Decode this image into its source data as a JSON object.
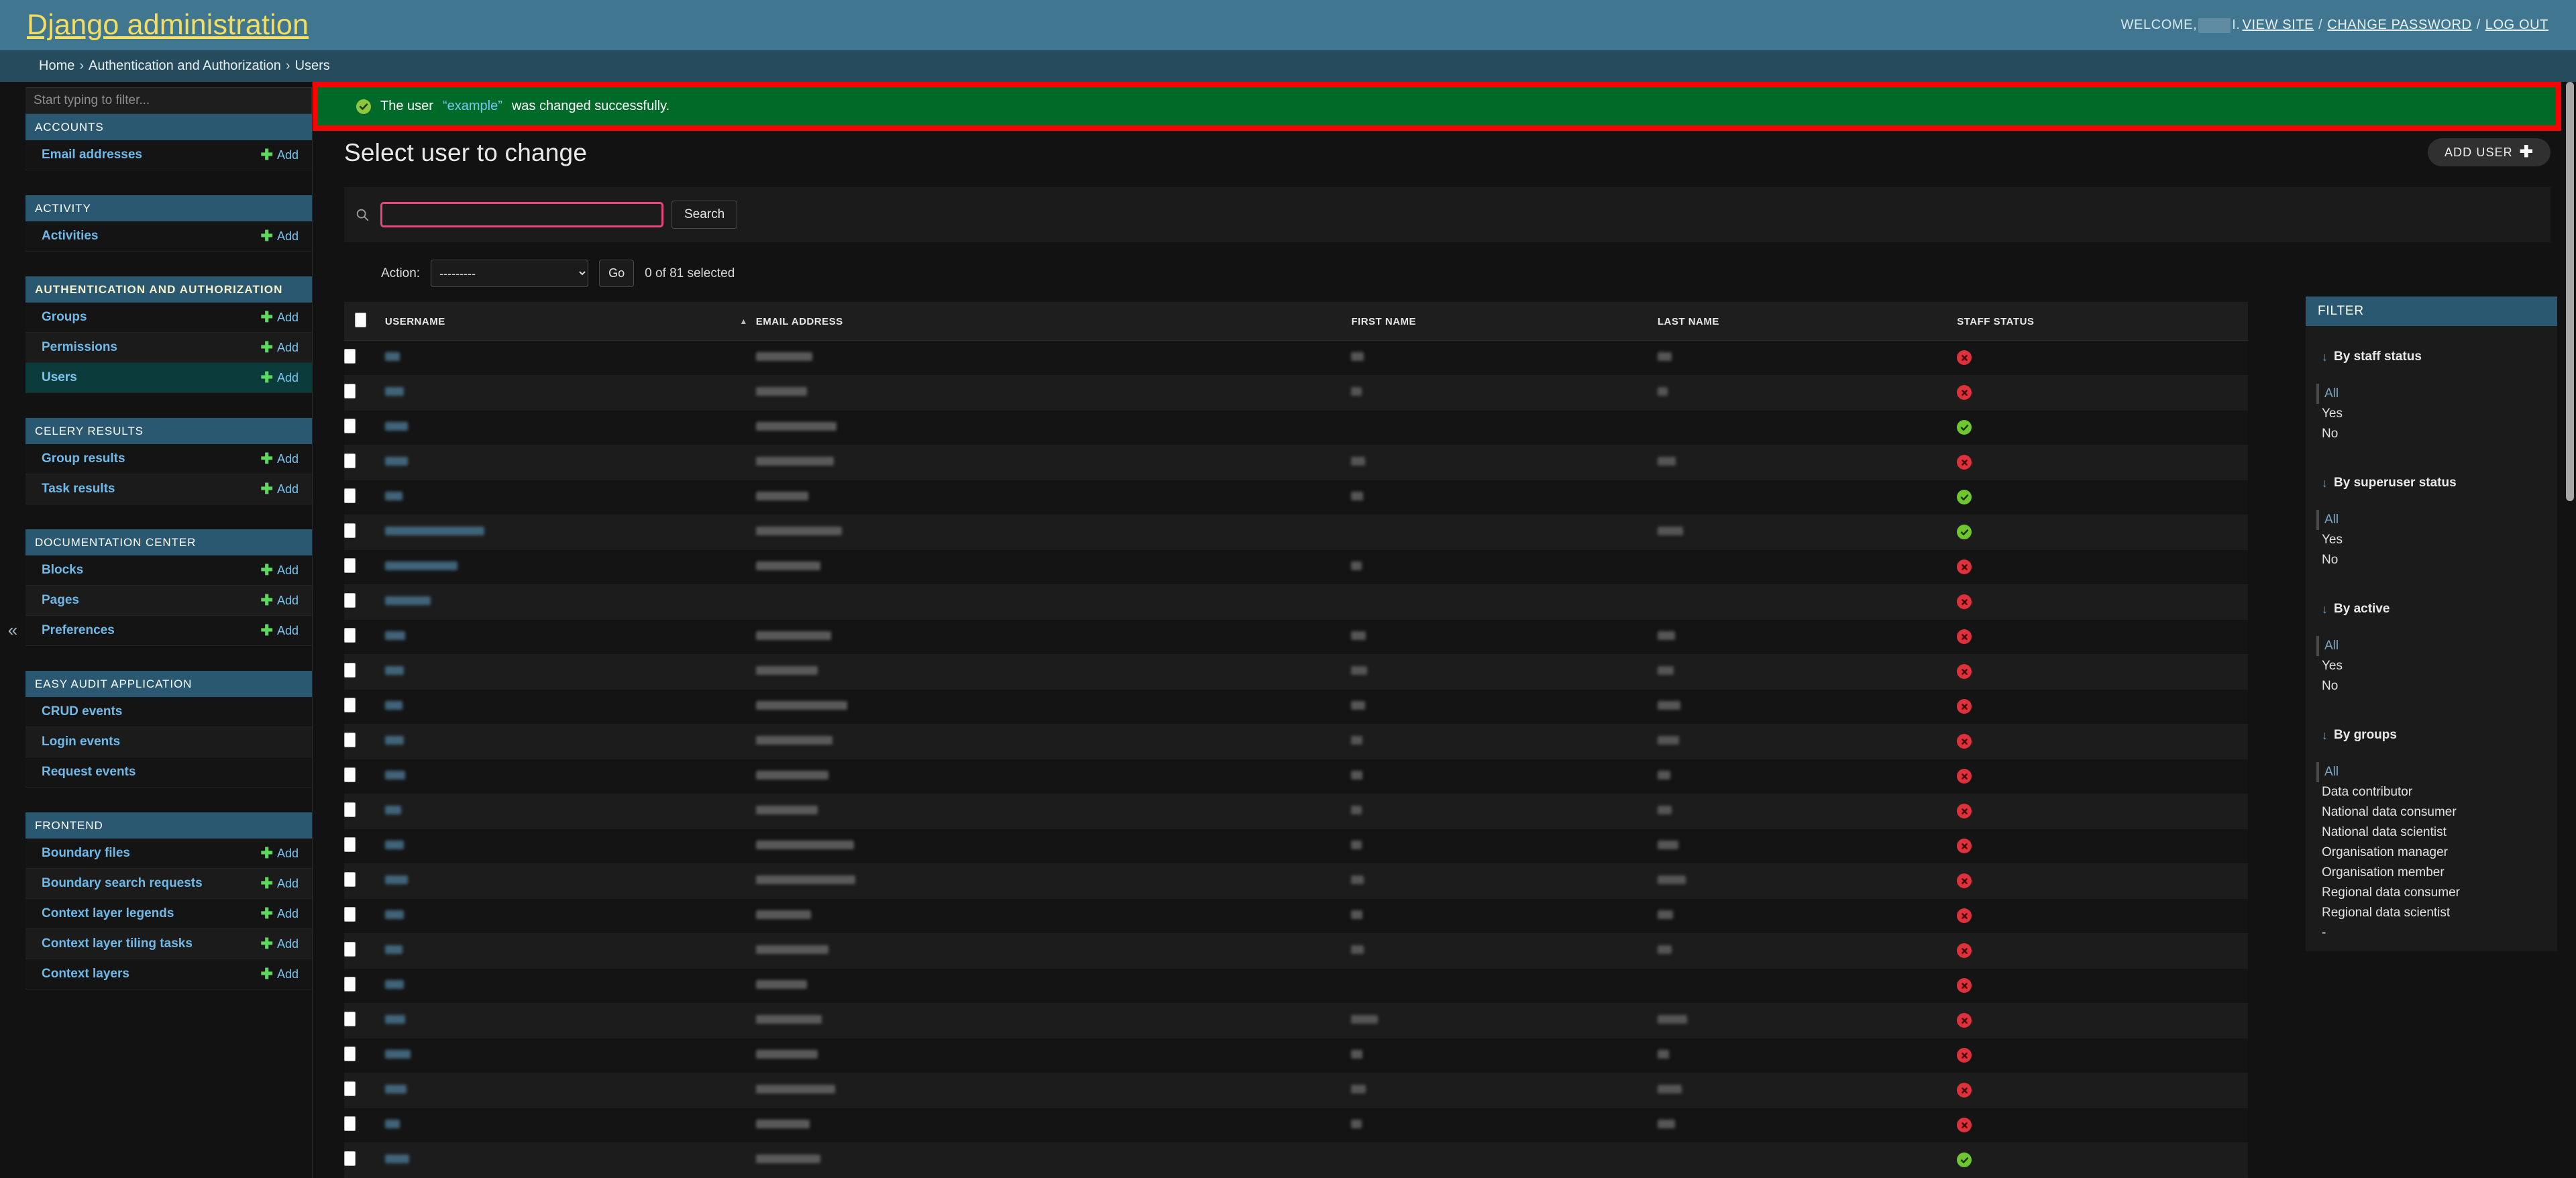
{
  "header": {
    "site_name": "Django administration",
    "welcome_label": "WELCOME,",
    "username_redacted": "",
    "username_suffix": "I.",
    "links": [
      {
        "label": "VIEW SITE"
      },
      {
        "label": "CHANGE PASSWORD"
      },
      {
        "label": "LOG OUT"
      }
    ],
    "separator": "/"
  },
  "breadcrumbs": {
    "items": [
      {
        "label": "Home"
      },
      {
        "label": "Authentication and Authorization"
      },
      {
        "label": "Users"
      }
    ],
    "separator": "›"
  },
  "message": {
    "text_before": "The user",
    "object_link": "“example”",
    "text_after": "was changed successfully.",
    "icon": "check-circle-icon",
    "background": "#006b28",
    "highlight_border": "#ff0000"
  },
  "nav_sidebar": {
    "filter_placeholder": "Start typing to filter...",
    "filter_value": "",
    "collapse_icon": "«",
    "add_label": "Add",
    "modules": [
      {
        "caption": "ACCOUNTS",
        "highlight": false,
        "items": [
          {
            "label": "Email addresses",
            "has_add": true,
            "current": false
          }
        ]
      },
      {
        "caption": "ACTIVITY",
        "highlight": false,
        "items": [
          {
            "label": "Activities",
            "has_add": true,
            "current": false
          }
        ]
      },
      {
        "caption": "AUTHENTICATION AND AUTHORIZATION",
        "highlight": true,
        "items": [
          {
            "label": "Groups",
            "has_add": true,
            "current": false
          },
          {
            "label": "Permissions",
            "has_add": true,
            "current": false
          },
          {
            "label": "Users",
            "has_add": true,
            "current": true
          }
        ]
      },
      {
        "caption": "CELERY RESULTS",
        "highlight": false,
        "items": [
          {
            "label": "Group results",
            "has_add": true,
            "current": false
          },
          {
            "label": "Task results",
            "has_add": true,
            "current": false
          }
        ]
      },
      {
        "caption": "DOCUMENTATION CENTER",
        "highlight": false,
        "items": [
          {
            "label": "Blocks",
            "has_add": true,
            "current": false
          },
          {
            "label": "Pages",
            "has_add": true,
            "current": false
          },
          {
            "label": "Preferences",
            "has_add": true,
            "current": false
          }
        ]
      },
      {
        "caption": "EASY AUDIT APPLICATION",
        "highlight": false,
        "items": [
          {
            "label": "CRUD events",
            "has_add": false,
            "current": false
          },
          {
            "label": "Login events",
            "has_add": false,
            "current": false
          },
          {
            "label": "Request events",
            "has_add": false,
            "current": false
          }
        ]
      },
      {
        "caption": "FRONTEND",
        "highlight": false,
        "items": [
          {
            "label": "Boundary files",
            "has_add": true,
            "current": false
          },
          {
            "label": "Boundary search requests",
            "has_add": true,
            "current": false
          },
          {
            "label": "Context layer legends",
            "has_add": true,
            "current": false
          },
          {
            "label": "Context layer tiling tasks",
            "has_add": true,
            "current": false
          },
          {
            "label": "Context layers",
            "has_add": true,
            "current": false
          }
        ]
      }
    ]
  },
  "main": {
    "page_title": "Select user to change",
    "add_button_label": "ADD USER",
    "search": {
      "placeholder": "",
      "value": "",
      "submit_label": "Search",
      "icon": "search-icon",
      "focus_outline_color": "#e8467c"
    },
    "actions": {
      "label": "Action:",
      "selected_option": "---------",
      "options": [
        "---------"
      ],
      "go_label": "Go",
      "counter": "0 of 81 selected"
    },
    "table": {
      "columns": [
        {
          "label": "USERNAME",
          "sorted": "asc"
        },
        {
          "label": "EMAIL ADDRESS",
          "sorted": ""
        },
        {
          "label": "FIRST NAME",
          "sorted": ""
        },
        {
          "label": "LAST NAME",
          "sorted": ""
        },
        {
          "label": "STAFF STATUS",
          "sorted": ""
        }
      ],
      "rows": [
        {
          "username_w": 22,
          "email_w": 84,
          "first_w": 19,
          "last_w": 21,
          "staff": "no"
        },
        {
          "username_w": 28,
          "email_w": 76,
          "first_w": 16,
          "last_w": 15,
          "staff": "no"
        },
        {
          "username_w": 34,
          "email_w": 120,
          "first_w": 0,
          "last_w": 0,
          "staff": "yes"
        },
        {
          "username_w": 34,
          "email_w": 116,
          "first_w": 21,
          "last_w": 27,
          "staff": "no"
        },
        {
          "username_w": 26,
          "email_w": 78,
          "first_w": 18,
          "last_w": 0,
          "staff": "yes"
        },
        {
          "username_w": 148,
          "email_w": 128,
          "first_w": 0,
          "last_w": 38,
          "staff": "yes"
        },
        {
          "username_w": 108,
          "email_w": 96,
          "first_w": 16,
          "last_w": 0,
          "staff": "no"
        },
        {
          "username_w": 68,
          "email_w": 0,
          "first_w": 0,
          "last_w": 0,
          "staff": "no"
        },
        {
          "username_w": 30,
          "email_w": 112,
          "first_w": 22,
          "last_w": 26,
          "staff": "no"
        },
        {
          "username_w": 28,
          "email_w": 92,
          "first_w": 24,
          "last_w": 24,
          "staff": "no"
        },
        {
          "username_w": 26,
          "email_w": 136,
          "first_w": 21,
          "last_w": 34,
          "staff": "no"
        },
        {
          "username_w": 28,
          "email_w": 114,
          "first_w": 17,
          "last_w": 32,
          "staff": "no"
        },
        {
          "username_w": 30,
          "email_w": 108,
          "first_w": 17,
          "last_w": 19,
          "staff": "no"
        },
        {
          "username_w": 24,
          "email_w": 92,
          "first_w": 16,
          "last_w": 21,
          "staff": "no"
        },
        {
          "username_w": 28,
          "email_w": 146,
          "first_w": 16,
          "last_w": 31,
          "staff": "no"
        },
        {
          "username_w": 34,
          "email_w": 148,
          "first_w": 19,
          "last_w": 42,
          "staff": "no"
        },
        {
          "username_w": 28,
          "email_w": 82,
          "first_w": 17,
          "last_w": 23,
          "staff": "no"
        },
        {
          "username_w": 26,
          "email_w": 108,
          "first_w": 19,
          "last_w": 21,
          "staff": "no"
        },
        {
          "username_w": 28,
          "email_w": 76,
          "first_w": 0,
          "last_w": 0,
          "staff": "no"
        },
        {
          "username_w": 30,
          "email_w": 98,
          "first_w": 40,
          "last_w": 44,
          "staff": "no"
        },
        {
          "username_w": 38,
          "email_w": 92,
          "first_w": 17,
          "last_w": 17,
          "staff": "no"
        },
        {
          "username_w": 32,
          "email_w": 118,
          "first_w": 22,
          "last_w": 36,
          "staff": "no"
        },
        {
          "username_w": 22,
          "email_w": 80,
          "first_w": 16,
          "last_w": 26,
          "staff": "no"
        },
        {
          "username_w": 36,
          "email_w": 96,
          "first_w": 0,
          "last_w": 0,
          "staff": "yes"
        }
      ]
    }
  },
  "filter_sidebar": {
    "header": "FILTER",
    "arrow_icon": "↓",
    "groups": [
      {
        "title": "By staff status",
        "options": [
          {
            "label": "All",
            "selected": true
          },
          {
            "label": "Yes",
            "selected": false
          },
          {
            "label": "No",
            "selected": false
          }
        ]
      },
      {
        "title": "By superuser status",
        "options": [
          {
            "label": "All",
            "selected": true
          },
          {
            "label": "Yes",
            "selected": false
          },
          {
            "label": "No",
            "selected": false
          }
        ]
      },
      {
        "title": "By active",
        "options": [
          {
            "label": "All",
            "selected": true
          },
          {
            "label": "Yes",
            "selected": false
          },
          {
            "label": "No",
            "selected": false
          }
        ]
      },
      {
        "title": "By groups",
        "options": [
          {
            "label": "All",
            "selected": true
          },
          {
            "label": "Data contributor",
            "selected": false
          },
          {
            "label": "National data consumer",
            "selected": false
          },
          {
            "label": "National data scientist",
            "selected": false
          },
          {
            "label": "Organisation manager",
            "selected": false
          },
          {
            "label": "Organisation member",
            "selected": false
          },
          {
            "label": "Regional data consumer",
            "selected": false
          },
          {
            "label": "Regional data scientist",
            "selected": false
          },
          {
            "label": "-",
            "selected": false
          }
        ]
      }
    ]
  },
  "colors": {
    "header_bg": "#417690",
    "breadcrumb_bg": "#264b5d",
    "body_bg": "#121212",
    "brand_yellow": "#f5dd5d",
    "link_blue": "#79c6f2",
    "success_green": "#006b28",
    "status_yes": "#6fc62e",
    "status_no": "#e0303b",
    "module_caption_bg": "#2b5871"
  }
}
